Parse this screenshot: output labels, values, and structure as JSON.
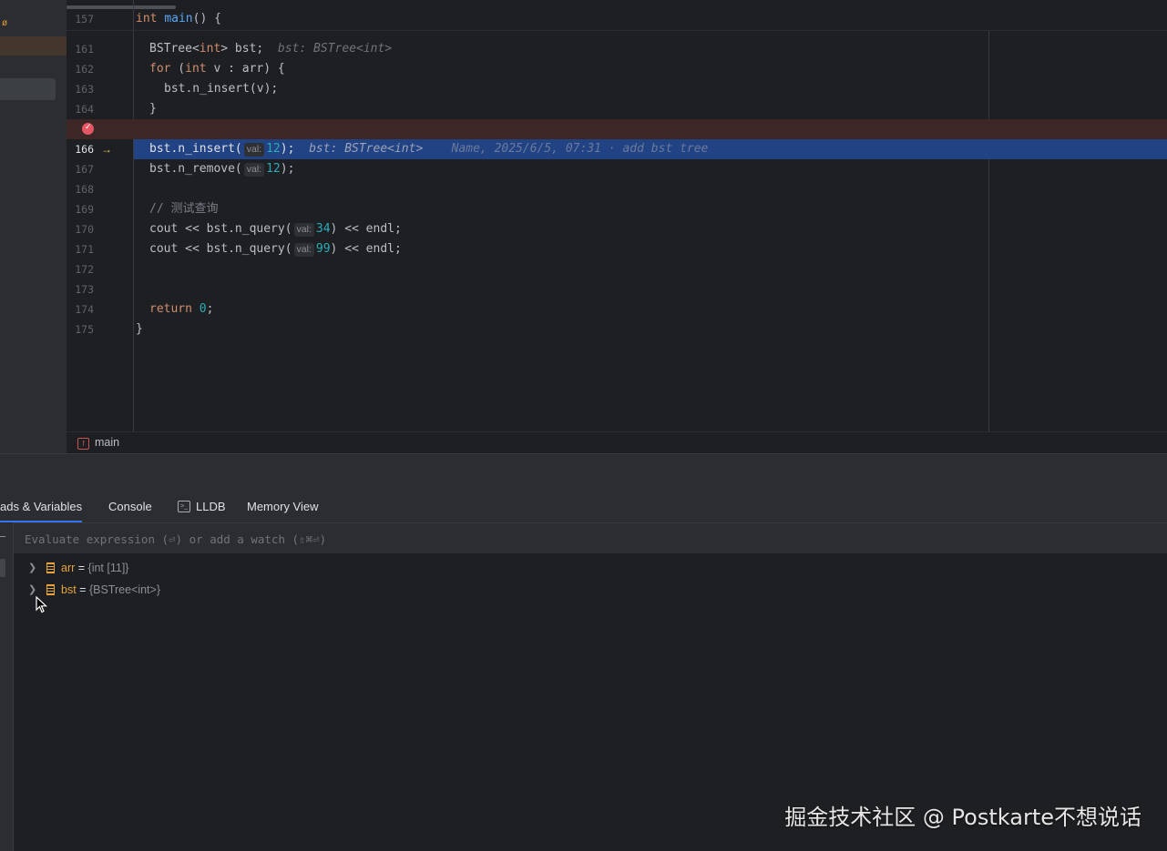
{
  "editor": {
    "lines": [
      {
        "n": "157",
        "code": "int main() {"
      },
      {
        "n": "161",
        "code": "BSTree<int> bst;",
        "hint": "bst: BSTree<int>"
      },
      {
        "n": "162",
        "code": "for (int v : arr) {"
      },
      {
        "n": "163",
        "code": "bst.n_insert(v);"
      },
      {
        "n": "164",
        "code": "}"
      },
      {
        "n": "166",
        "code": "bst.n_insert(",
        "param": "val:",
        "arg": "12",
        "tail": ");",
        "hint": "bst: BSTree<int>",
        "blame": "Name, 2025/6/5, 07:31 · add bst tree"
      },
      {
        "n": "167",
        "code": "bst.n_remove(",
        "param": "val:",
        "arg": "12",
        "tail": ");"
      },
      {
        "n": "168",
        "code": ""
      },
      {
        "n": "169",
        "code": "// 测试查询"
      },
      {
        "n": "170",
        "code": "cout << bst.n_query(",
        "param": "val:",
        "arg": "34",
        "tail": ") << endl;"
      },
      {
        "n": "171",
        "code": "cout << bst.n_query(",
        "param": "val:",
        "arg": "99",
        "tail": ") << endl;"
      },
      {
        "n": "172",
        "code": ""
      },
      {
        "n": "173",
        "code": ""
      },
      {
        "n": "174",
        "code": "return 0;"
      },
      {
        "n": "175",
        "code": "}"
      }
    ]
  },
  "breadcrumb": {
    "icon_letter": "f",
    "label": "main"
  },
  "debug": {
    "tabs": {
      "threads": "ads & Variables",
      "console": "Console",
      "lldb_icon": ">_",
      "lldb": "LLDB",
      "memory": "Memory View"
    },
    "eval_placeholder": "Evaluate expression (⏎) or add a watch (⇧⌘⏎)",
    "variables": [
      {
        "name": "arr",
        "eq": " = ",
        "value": "{int [11]}"
      },
      {
        "name": "bst",
        "eq": " = ",
        "value": "{BSTree<int>}"
      }
    ]
  },
  "left": {
    "mark": "ø"
  },
  "watermark": "掘金技术社区 @ Postkarte不想说话",
  "colors": {
    "execution_line": "#214283",
    "breakpoint": "#e55765",
    "accent": "#3574f0"
  }
}
